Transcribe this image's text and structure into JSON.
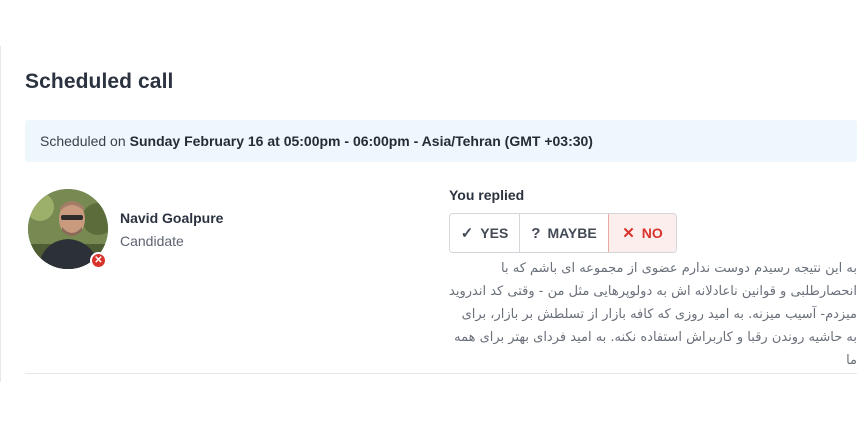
{
  "section": {
    "title": "Scheduled call"
  },
  "schedule": {
    "prefix": "Scheduled on",
    "datetime": "Sunday February 16 at 05:00pm - 06:00pm - Asia/Tehran (GMT +03:30)"
  },
  "participant": {
    "name": "Navid Goalpure",
    "role": "Candidate",
    "status_icon": "x-icon",
    "status_color": "#d9342b"
  },
  "reply": {
    "label": "You replied",
    "options": [
      {
        "label": "YES",
        "icon": "check-icon",
        "symbol": "✓",
        "selected": false
      },
      {
        "label": "MAYBE",
        "icon": "question-icon",
        "symbol": "?",
        "selected": false
      },
      {
        "label": "NO",
        "icon": "x-icon",
        "symbol": "✕",
        "selected": true
      }
    ],
    "selected_color": "#d9342b",
    "comment": "به این نتیجه رسیدم دوست ندارم عضوی از مجموعه ای باشم که با انحصارطلبی و قوانین ناعادلانه اش به دولوپرهایی مثل من - وقتی کد اندروید میزدم- آسیب میزنه. به امید روزی که کافه بازار از تسلطش بر بازار، برای به حاشیه روندن رقبا و کاربراش استفاده نکنه. به امید فردای بهتر برای همه ما"
  }
}
